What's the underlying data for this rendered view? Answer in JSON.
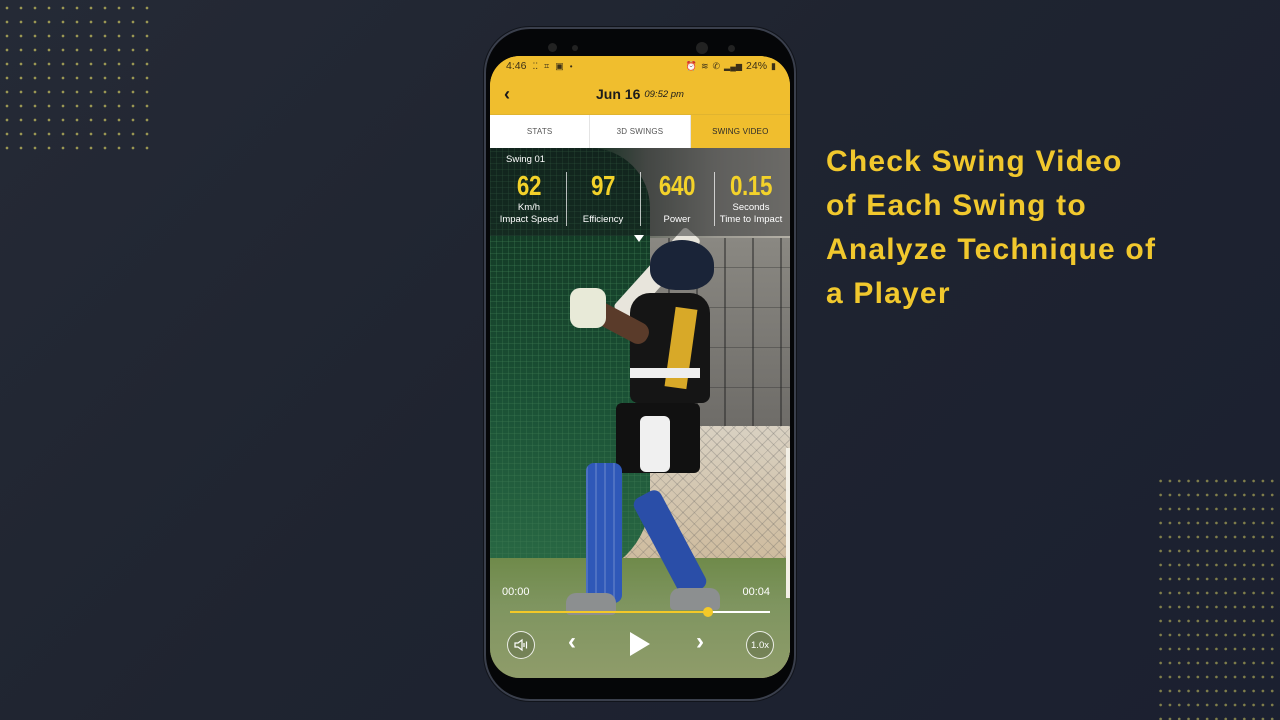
{
  "headline": {
    "lines": [
      "Check Swing Video",
      "of Each Swing to",
      "Analyze Technique of",
      "a Player"
    ],
    "color": "#f1c82d"
  },
  "phone": {
    "statusbar": {
      "time": "4:46",
      "left_icons": [
        "screenshot-icon",
        "scan-icon",
        "cast-icon",
        "dot-icon"
      ],
      "right_icons": [
        "alarm-icon",
        "wifi-icon",
        "volte-call-icon",
        "signal-icon",
        "signal-2-icon"
      ],
      "battery": "24%"
    },
    "appbar": {
      "back_icon": "chevron-left-icon",
      "date": "Jun 16",
      "time": "09:52 pm",
      "accent": "#f0be2e"
    },
    "tabs": [
      {
        "label": "STATS",
        "active": false
      },
      {
        "label": "3D SWINGS",
        "active": false
      },
      {
        "label": "SWING VIDEO",
        "active": true
      }
    ],
    "swing": {
      "label": "Swing  01",
      "metrics": [
        {
          "value": "62",
          "unit": "Km/h",
          "name": "Impact Speed"
        },
        {
          "value": "97",
          "unit": "",
          "name": "Efficiency"
        },
        {
          "value": "640",
          "unit": "",
          "name": "Power"
        },
        {
          "value": "0.15",
          "unit": "Seconds",
          "name": "Time to Impact"
        }
      ]
    },
    "player": {
      "current_time": "00:00",
      "duration": "00:04",
      "progress_fraction": 0.76,
      "speed_label": "1.0x",
      "buttons": {
        "mute": "volume-icon",
        "prev": "‹",
        "play": "play-icon",
        "next": "›"
      }
    }
  }
}
